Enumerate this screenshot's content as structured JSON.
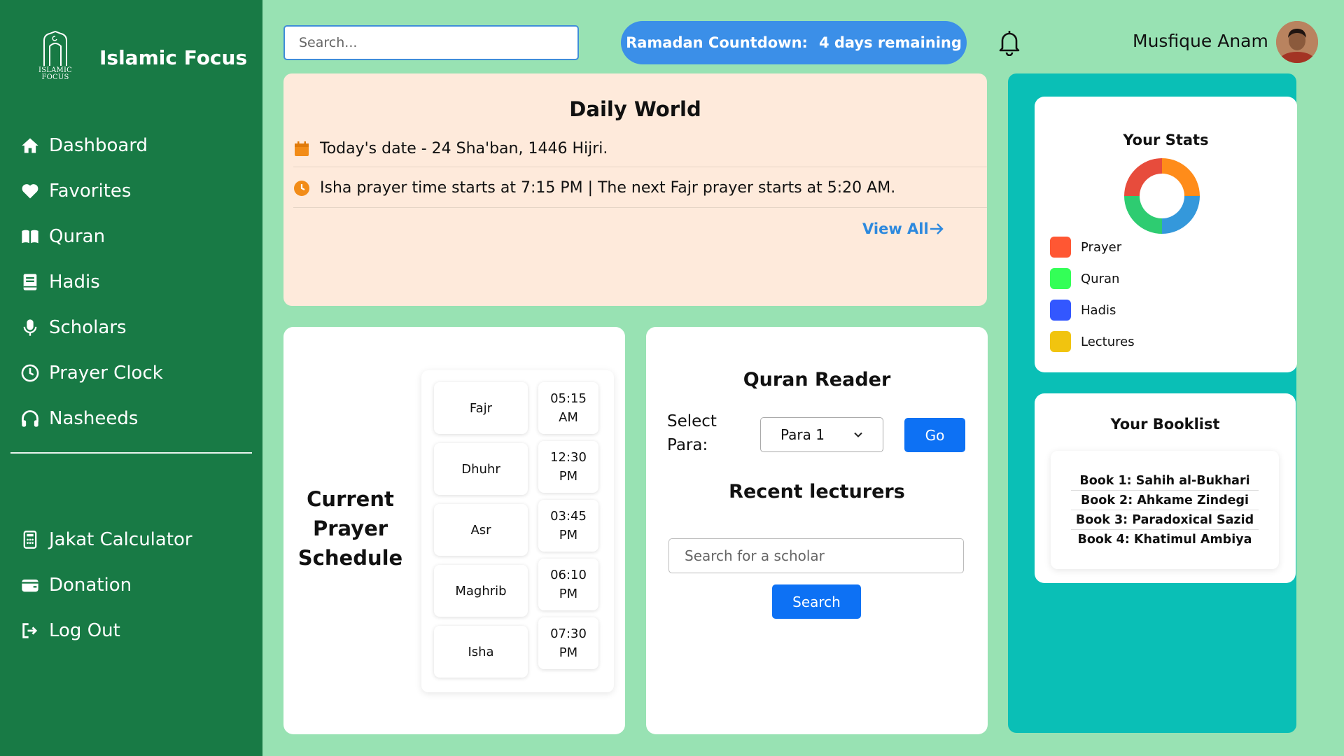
{
  "brand": {
    "name": "Islamic Focus",
    "logo_text_top": "ISLAMIC",
    "logo_text_bottom": "FOCUS"
  },
  "sidebar": {
    "items": [
      {
        "label": "Dashboard",
        "icon": "home-icon"
      },
      {
        "label": "Favorites",
        "icon": "heart-icon"
      },
      {
        "label": "Quran",
        "icon": "book-open-icon"
      },
      {
        "label": "Hadis",
        "icon": "book-icon"
      },
      {
        "label": "Scholars",
        "icon": "microphone-icon"
      },
      {
        "label": "Prayer Clock",
        "icon": "clock-icon"
      },
      {
        "label": "Nasheeds",
        "icon": "headphones-icon"
      }
    ],
    "bottom_items": [
      {
        "label": "Jakat Calculator",
        "icon": "calculator-icon"
      },
      {
        "label": "Donation",
        "icon": "wallet-icon"
      },
      {
        "label": "Log Out",
        "icon": "logout-icon"
      }
    ]
  },
  "header": {
    "search_placeholder": "Search...",
    "countdown_label": "Ramadan Countdown:",
    "countdown_value": "4 days remaining",
    "user_name": "Musfique Anam"
  },
  "daily": {
    "title": "Daily World",
    "date_text": "Today's date - 24 Sha'ban, 1446 Hijri.",
    "prayer_text": "Isha prayer time starts at 7:15 PM | The next Fajr prayer starts at 5:20 AM.",
    "view_all": "View All"
  },
  "prayer_schedule": {
    "title_lines": [
      "Current",
      "Prayer",
      "Schedule"
    ],
    "rows": [
      {
        "name": "Fajr",
        "time": "05:15",
        "period": "AM"
      },
      {
        "name": "Dhuhr",
        "time": "12:30",
        "period": "PM"
      },
      {
        "name": "Asr",
        "time": "03:45",
        "period": "PM"
      },
      {
        "name": "Maghrib",
        "time": "06:10",
        "period": "PM"
      },
      {
        "name": "Isha",
        "time": "07:30",
        "period": "PM"
      }
    ]
  },
  "quran_reader": {
    "title": "Quran Reader",
    "select_label_1": "Select",
    "select_label_2": "Para:",
    "selected_para": "Para 1",
    "go_label": "Go",
    "lecturers_title": "Recent lecturers",
    "scholar_placeholder": "Search for a scholar",
    "search_label": "Search"
  },
  "stats": {
    "title": "Your Stats",
    "legend": [
      {
        "label": "Prayer",
        "color": "#ff5733"
      },
      {
        "label": "Quran",
        "color": "#33ff57"
      },
      {
        "label": "Hadis",
        "color": "#3357ff"
      },
      {
        "label": "Lectures",
        "color": "#f1c40f"
      }
    ],
    "donut_colors": [
      "#e74c3c",
      "#ff8c1a",
      "#3498db",
      "#2ecc71"
    ]
  },
  "booklist": {
    "title": "Your Booklist",
    "books": [
      "Book 1: Sahih al-Bukhari",
      "Book 2: Ahkame Zindegi",
      "Book 3: Paradoxical Sazid",
      "Book 4: Khatimul Ambiya"
    ]
  }
}
